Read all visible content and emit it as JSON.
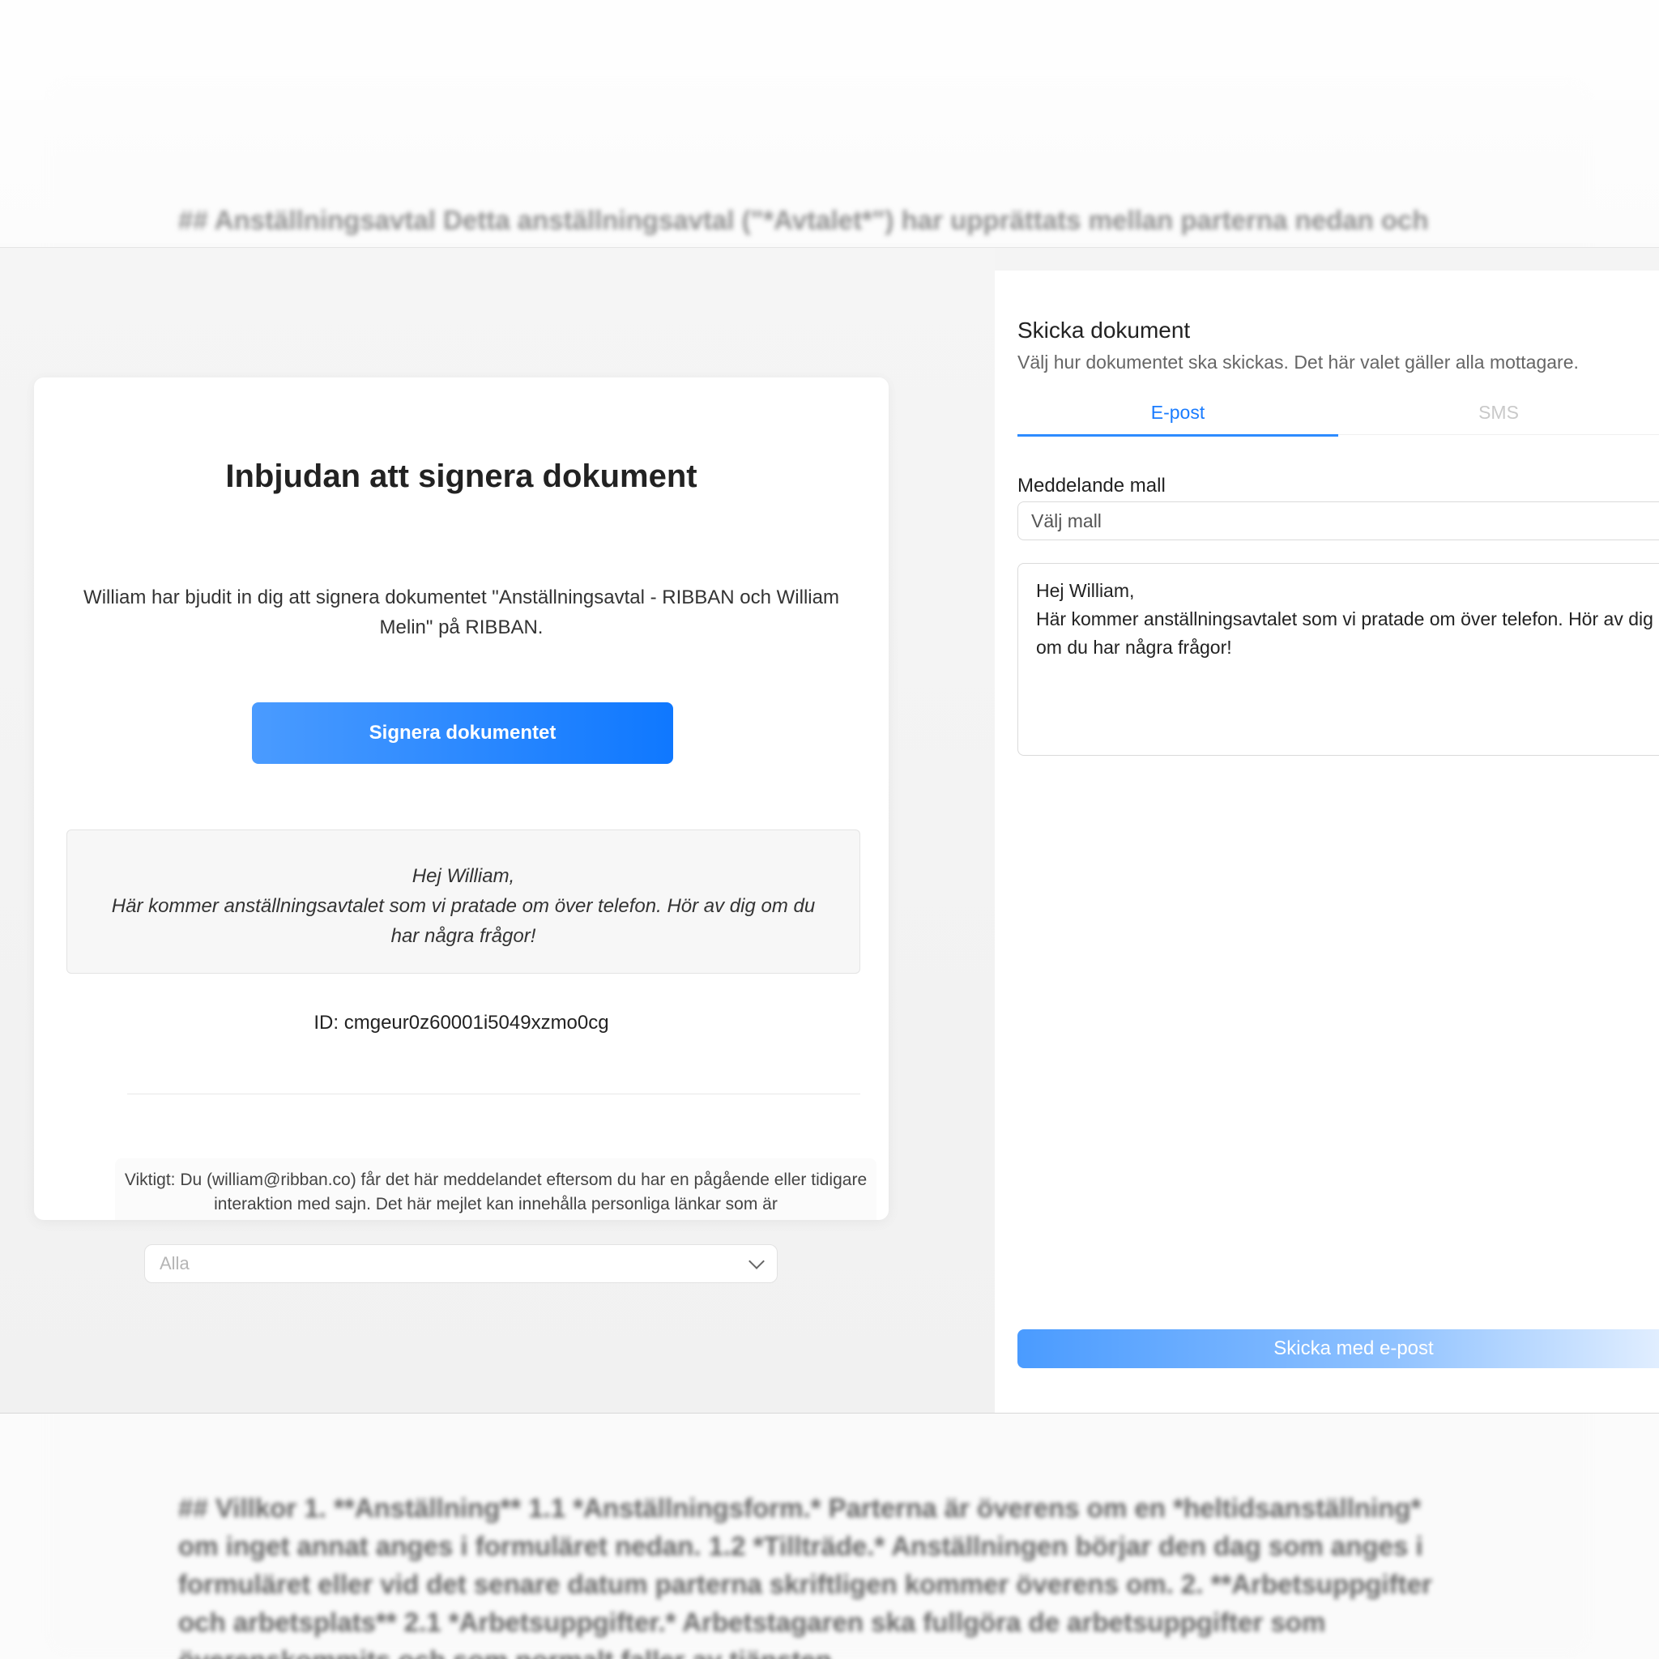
{
  "background": {
    "top_line": "## Anställningsavtal Detta anställningsavtal (\"*Avtalet*\") har upprättats mellan parterna nedan och",
    "bottom_paragraph": "## Villkor 1. **Anställning** 1.1 *Anställningsform.* Parterna är överens om en *heltidsanställning* om inget annat anges i formuläret nedan. 1.2 *Tillträde.* Anställningen börjar den dag som anges i formuläret eller vid det senare datum parterna skriftligen kommer överens om. 2. **Arbetsuppgifter och arbetsplats** 2.1 *Arbetsuppgifter.* Arbetstagaren ska fullgöra de arbetsuppgifter som överenskommits och som normalt faller av tjänsten"
  },
  "email_preview": {
    "title": "Inbjudan att signera dokument",
    "intro": "William har bjudit in dig att signera dokumentet \"Anställningsavtal - RIBBAN och William Melin\" på RIBBAN.",
    "sign_button": "Signera dokumentet",
    "message": "Hej William,\nHär kommer anställningsavtalet som vi pratade om över telefon. Hör av dig om du har några frågor!",
    "id_line": "ID: cmgeur0z60001i5049xzmo0cg",
    "notice": "Viktigt: Du (william@ribban.co) får det här meddelandet eftersom du har en pågående eller tidigare interaktion med sajn. Det här mejlet kan innehålla personliga länkar som är"
  },
  "filter_select": {
    "value": "Alla"
  },
  "send_panel": {
    "title": "Skicka dokument",
    "subtitle": "Välj hur dokumentet ska skickas. Det här valet gäller alla mottagare.",
    "tabs": [
      {
        "label": "E-post",
        "active": true
      },
      {
        "label": "SMS",
        "active": false
      }
    ],
    "template_label": "Meddelande mall",
    "template_placeholder": "Välj mall",
    "message_text": "Hej William,\nHär kommer anställningsavtalet som vi pratade om över telefon. Hör av dig om du har några frågor!",
    "send_button": "Skicka med e-post"
  },
  "colors": {
    "accent": "#1a7cff",
    "button_gradient_start": "#4a9bff",
    "button_gradient_end": "#0f78ff"
  }
}
